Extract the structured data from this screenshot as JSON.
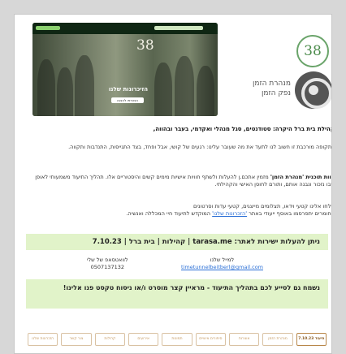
{
  "header": {
    "hero_title": "הזיכרונות שלנו",
    "hero_button": "הצטרפו להצגה",
    "logo_text": "38",
    "org_name": "מנהרת הזמן נפק הזמן"
  },
  "body": {
    "heading": "קהילת בית ברל היקרה: סטודנטים, סגל מנהלי ואקדמי, בעבר ובהווה,",
    "intro": "בתקופה מורכבת זו חשוב לנו לתעד את מה שעובר עלינו: רגעים של קושי, אבל ופחד, בצד התגייסות, התנדבות ותקווה.",
    "program_bold": "צוות תוכנית 'מנהרת הזמן'",
    "program_text": " מזמין אתכם.ן להעלות ולשתף חוויות אישיות מימים קשים והיסטוריים אלו. תהליך התיעוד משמעותי לאופן שבו נזכור ונבנה אותם, ותורם לחוסן האישי והקהילתי.",
    "send_line": "שלחו אלינו קטעי וידאו, תצלומים מייצגים, קטעי עדות וסרטונים",
    "archive_prefix": "החומרים יתפרסמו באוסף ייעודי באתר ",
    "archive_link": "'הזכרונות שלנו'",
    "archive_suffix": " המוקדש לתיעוד חיי המכללה ואנשיה."
  },
  "cta": {
    "bar_text": "ניתן להעלות ישירות לאתר: tarasa.me | קהילות | בית ברל | 7.10.23",
    "contact_right_label": "למייל שלנו",
    "contact_right_value": "timetunnelbeitberl@gmail.com",
    "contact_left_label": "לוואטסאפ של שלי",
    "contact_left_value": "0507137132",
    "message": "נשמח גם לסייע לכם בתהליך התיעוד - מראיין קצר מוסרט ו/או ניסוח טקסט פנו אלינו!"
  },
  "nav": [
    {
      "label": "7.10.23 תיעוד",
      "active": true
    },
    {
      "label": "מנהרת הזמן",
      "active": false
    },
    {
      "label": "אוצרות",
      "active": false
    },
    {
      "label": "סיפורים אישיים",
      "active": false
    },
    {
      "label": "תמונות",
      "active": false
    },
    {
      "label": "אירועים",
      "active": false
    },
    {
      "label": "קהילות",
      "active": false
    },
    {
      "label": "צור קשר",
      "active": false
    },
    {
      "label": "הזכרונות שלנו",
      "active": false
    }
  ],
  "colors": {
    "cta_background": "#e1f3c9",
    "nav_accent": "#c69a62",
    "logo_green": "#4b8b4b"
  }
}
